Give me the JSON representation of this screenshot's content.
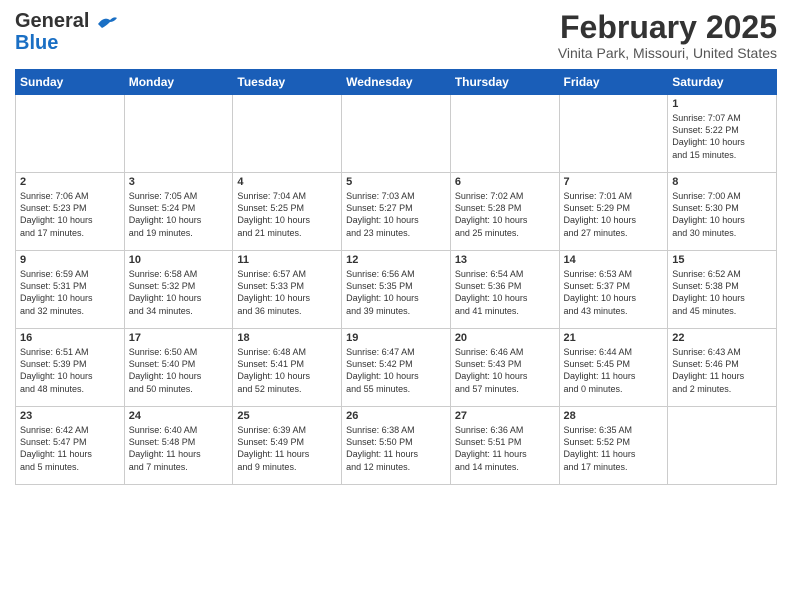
{
  "header": {
    "logo_line1": "General",
    "logo_line2": "Blue",
    "month_year": "February 2025",
    "location": "Vinita Park, Missouri, United States"
  },
  "weekdays": [
    "Sunday",
    "Monday",
    "Tuesday",
    "Wednesday",
    "Thursday",
    "Friday",
    "Saturday"
  ],
  "weeks": [
    [
      {
        "day": "",
        "info": ""
      },
      {
        "day": "",
        "info": ""
      },
      {
        "day": "",
        "info": ""
      },
      {
        "day": "",
        "info": ""
      },
      {
        "day": "",
        "info": ""
      },
      {
        "day": "",
        "info": ""
      },
      {
        "day": "1",
        "info": "Sunrise: 7:07 AM\nSunset: 5:22 PM\nDaylight: 10 hours\nand 15 minutes."
      }
    ],
    [
      {
        "day": "2",
        "info": "Sunrise: 7:06 AM\nSunset: 5:23 PM\nDaylight: 10 hours\nand 17 minutes."
      },
      {
        "day": "3",
        "info": "Sunrise: 7:05 AM\nSunset: 5:24 PM\nDaylight: 10 hours\nand 19 minutes."
      },
      {
        "day": "4",
        "info": "Sunrise: 7:04 AM\nSunset: 5:25 PM\nDaylight: 10 hours\nand 21 minutes."
      },
      {
        "day": "5",
        "info": "Sunrise: 7:03 AM\nSunset: 5:27 PM\nDaylight: 10 hours\nand 23 minutes."
      },
      {
        "day": "6",
        "info": "Sunrise: 7:02 AM\nSunset: 5:28 PM\nDaylight: 10 hours\nand 25 minutes."
      },
      {
        "day": "7",
        "info": "Sunrise: 7:01 AM\nSunset: 5:29 PM\nDaylight: 10 hours\nand 27 minutes."
      },
      {
        "day": "8",
        "info": "Sunrise: 7:00 AM\nSunset: 5:30 PM\nDaylight: 10 hours\nand 30 minutes."
      }
    ],
    [
      {
        "day": "9",
        "info": "Sunrise: 6:59 AM\nSunset: 5:31 PM\nDaylight: 10 hours\nand 32 minutes."
      },
      {
        "day": "10",
        "info": "Sunrise: 6:58 AM\nSunset: 5:32 PM\nDaylight: 10 hours\nand 34 minutes."
      },
      {
        "day": "11",
        "info": "Sunrise: 6:57 AM\nSunset: 5:33 PM\nDaylight: 10 hours\nand 36 minutes."
      },
      {
        "day": "12",
        "info": "Sunrise: 6:56 AM\nSunset: 5:35 PM\nDaylight: 10 hours\nand 39 minutes."
      },
      {
        "day": "13",
        "info": "Sunrise: 6:54 AM\nSunset: 5:36 PM\nDaylight: 10 hours\nand 41 minutes."
      },
      {
        "day": "14",
        "info": "Sunrise: 6:53 AM\nSunset: 5:37 PM\nDaylight: 10 hours\nand 43 minutes."
      },
      {
        "day": "15",
        "info": "Sunrise: 6:52 AM\nSunset: 5:38 PM\nDaylight: 10 hours\nand 45 minutes."
      }
    ],
    [
      {
        "day": "16",
        "info": "Sunrise: 6:51 AM\nSunset: 5:39 PM\nDaylight: 10 hours\nand 48 minutes."
      },
      {
        "day": "17",
        "info": "Sunrise: 6:50 AM\nSunset: 5:40 PM\nDaylight: 10 hours\nand 50 minutes."
      },
      {
        "day": "18",
        "info": "Sunrise: 6:48 AM\nSunset: 5:41 PM\nDaylight: 10 hours\nand 52 minutes."
      },
      {
        "day": "19",
        "info": "Sunrise: 6:47 AM\nSunset: 5:42 PM\nDaylight: 10 hours\nand 55 minutes."
      },
      {
        "day": "20",
        "info": "Sunrise: 6:46 AM\nSunset: 5:43 PM\nDaylight: 10 hours\nand 57 minutes."
      },
      {
        "day": "21",
        "info": "Sunrise: 6:44 AM\nSunset: 5:45 PM\nDaylight: 11 hours\nand 0 minutes."
      },
      {
        "day": "22",
        "info": "Sunrise: 6:43 AM\nSunset: 5:46 PM\nDaylight: 11 hours\nand 2 minutes."
      }
    ],
    [
      {
        "day": "23",
        "info": "Sunrise: 6:42 AM\nSunset: 5:47 PM\nDaylight: 11 hours\nand 5 minutes."
      },
      {
        "day": "24",
        "info": "Sunrise: 6:40 AM\nSunset: 5:48 PM\nDaylight: 11 hours\nand 7 minutes."
      },
      {
        "day": "25",
        "info": "Sunrise: 6:39 AM\nSunset: 5:49 PM\nDaylight: 11 hours\nand 9 minutes."
      },
      {
        "day": "26",
        "info": "Sunrise: 6:38 AM\nSunset: 5:50 PM\nDaylight: 11 hours\nand 12 minutes."
      },
      {
        "day": "27",
        "info": "Sunrise: 6:36 AM\nSunset: 5:51 PM\nDaylight: 11 hours\nand 14 minutes."
      },
      {
        "day": "28",
        "info": "Sunrise: 6:35 AM\nSunset: 5:52 PM\nDaylight: 11 hours\nand 17 minutes."
      },
      {
        "day": "",
        "info": ""
      }
    ]
  ]
}
